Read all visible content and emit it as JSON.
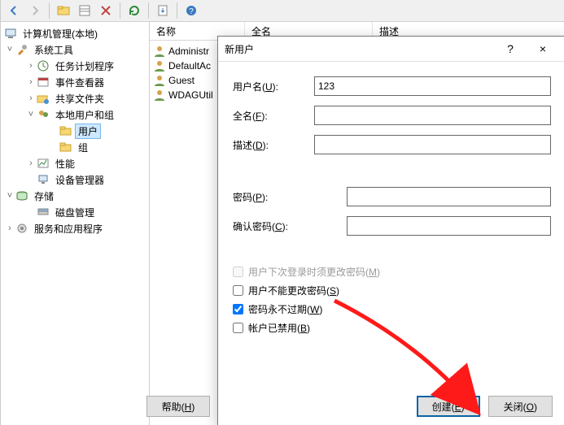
{
  "toolbar": {
    "icons": [
      "back",
      "forward",
      "folder",
      "table",
      "close",
      "refresh",
      "columns",
      "help"
    ]
  },
  "tree": {
    "root": "计算机管理(本地)",
    "nodes": [
      {
        "label": "系统工具",
        "expanded": true,
        "children": [
          {
            "label": "任务计划程序",
            "icon": "clock"
          },
          {
            "label": "事件查看器",
            "icon": "event"
          },
          {
            "label": "共享文件夹",
            "icon": "share"
          },
          {
            "label": "本地用户和组",
            "expanded": true,
            "icon": "users",
            "children": [
              {
                "label": "用户",
                "icon": "folder",
                "selected": true
              },
              {
                "label": "组",
                "icon": "folder"
              }
            ]
          },
          {
            "label": "性能",
            "icon": "perf"
          },
          {
            "label": "设备管理器",
            "icon": "device"
          }
        ]
      },
      {
        "label": "存储",
        "expanded": true,
        "children": [
          {
            "label": "磁盘管理",
            "icon": "disk"
          }
        ]
      },
      {
        "label": "服务和应用程序",
        "expanded": false,
        "icon": "service"
      }
    ]
  },
  "list": {
    "headers": {
      "name": "名称",
      "fullname": "全名",
      "desc": "描述"
    },
    "rows": [
      {
        "name": "Administr"
      },
      {
        "name": "DefaultAc"
      },
      {
        "name": "Guest"
      },
      {
        "name": "WDAGUtil"
      }
    ]
  },
  "dialog": {
    "title": "新用户",
    "help_symbol": "?",
    "close_symbol": "×",
    "fields": {
      "username": {
        "label": "用户名(",
        "u": "U",
        "suffix": "):",
        "value": "123"
      },
      "fullname": {
        "label": "全名(",
        "u": "F",
        "suffix": "):",
        "value": ""
      },
      "desc": {
        "label": "描述(",
        "u": "D",
        "suffix": "):",
        "value": ""
      },
      "password": {
        "label": "密码(",
        "u": "P",
        "suffix": "):",
        "value": ""
      },
      "confirm": {
        "label": "确认密码(",
        "u": "C",
        "suffix": "):",
        "value": ""
      }
    },
    "checks": {
      "must_change": {
        "label_pre": "用户下次登录时须更改密码(",
        "u": "M",
        "suffix": ")",
        "checked": false,
        "disabled": true
      },
      "cannot_change": {
        "label_pre": "用户不能更改密码(",
        "u": "S",
        "suffix": ")",
        "checked": false
      },
      "never_expires": {
        "label_pre": "密码永不过期(",
        "u": "W",
        "suffix": ")",
        "checked": true
      },
      "disabled_acct": {
        "label_pre": "帐户已禁用(",
        "u": "B",
        "suffix": ")",
        "checked": false
      }
    },
    "buttons": {
      "help": {
        "pre": "帮助(",
        "u": "H",
        "suf": ")"
      },
      "create": {
        "pre": "创建(",
        "u": "E",
        "suf": ")"
      },
      "close": {
        "pre": "关闭(",
        "u": "O",
        "suf": ")"
      }
    }
  }
}
